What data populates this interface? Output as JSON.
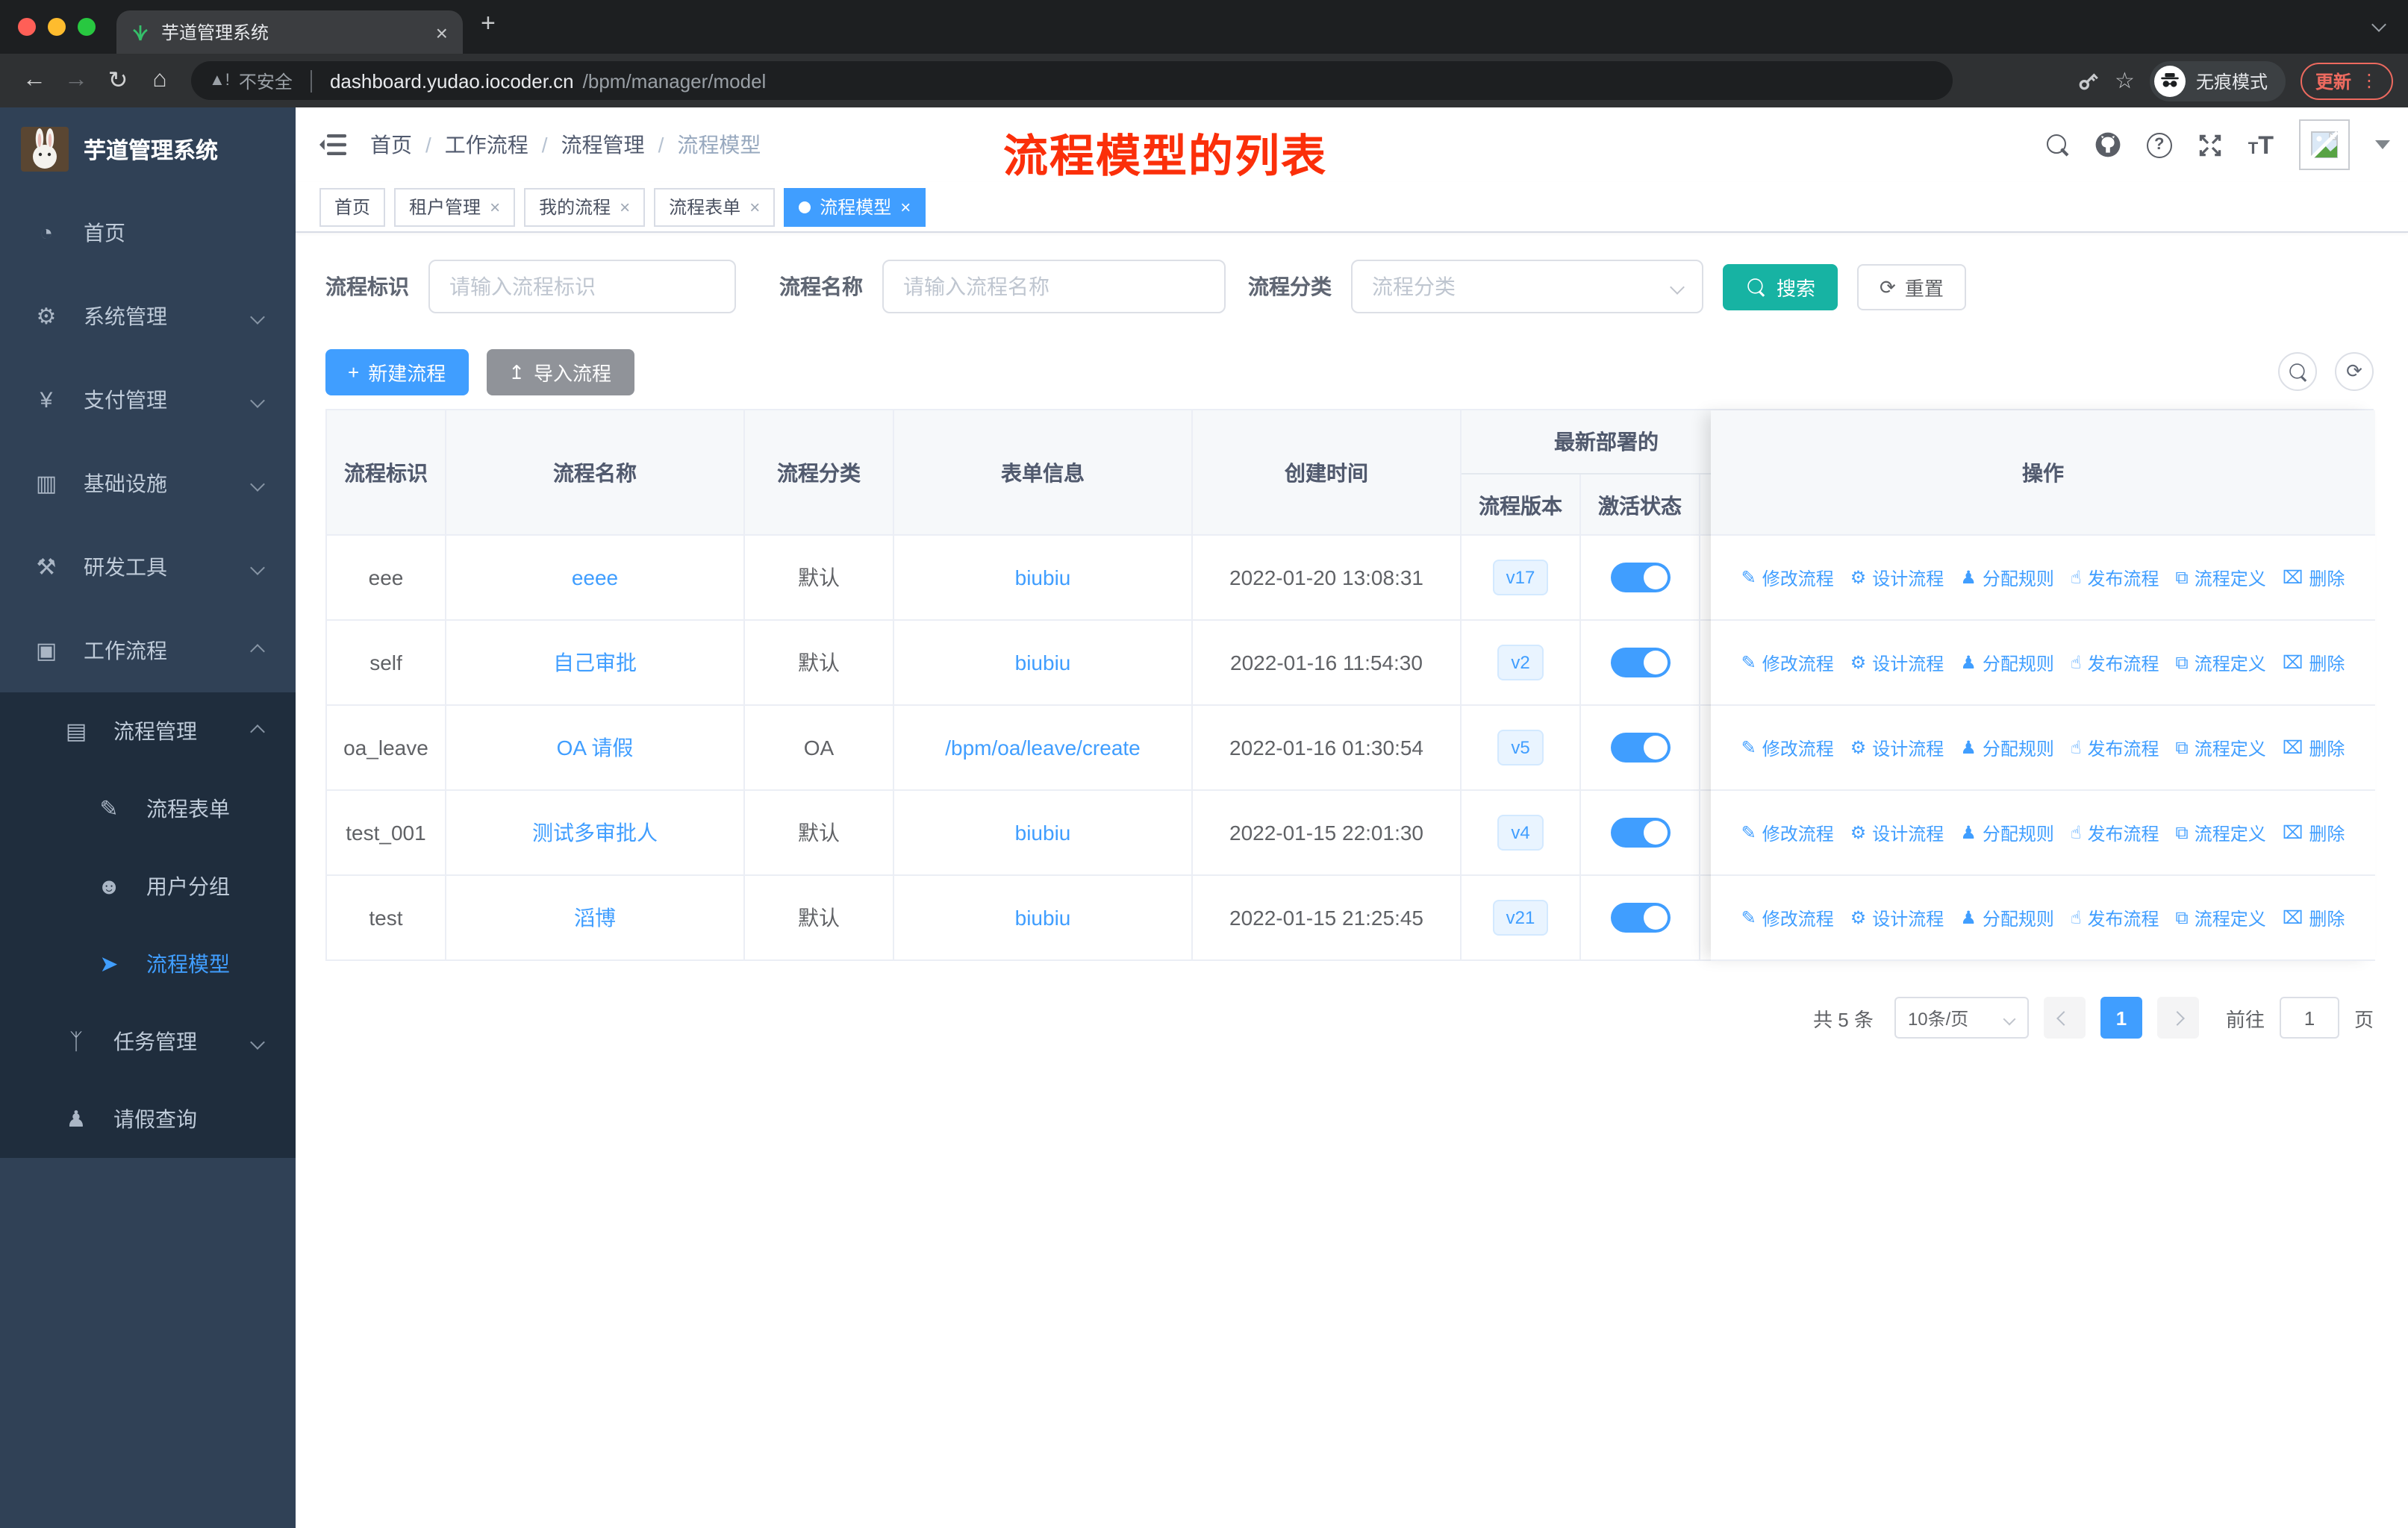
{
  "colors": {
    "primary": "#409eff",
    "search_button": "#17b3a3",
    "annotation_red": "#fb2f0a",
    "sidebar_bg": "#304156",
    "submenu_bg": "#1f2d3d"
  },
  "browser": {
    "tab_title": "芋道管理系统",
    "security_label": "不安全",
    "url_domain": "dashboard.yudao.iocoder.cn",
    "url_path": "/bpm/manager/model",
    "incognito_label": "无痕模式",
    "update_label": "更新"
  },
  "sidebar": {
    "app_title": "芋道管理系统",
    "menu": [
      {
        "key": "home",
        "label": "首页",
        "icon": "dashboard"
      },
      {
        "key": "system-management",
        "label": "系统管理",
        "icon": "gear",
        "chevron": "down"
      },
      {
        "key": "payment-management",
        "label": "支付管理",
        "icon": "yen",
        "chevron": "down"
      },
      {
        "key": "infrastructure",
        "label": "基础设施",
        "icon": "monitor",
        "chevron": "down"
      },
      {
        "key": "dev-tools",
        "label": "研发工具",
        "icon": "toolbox",
        "chevron": "down"
      },
      {
        "key": "workflow",
        "label": "工作流程",
        "icon": "briefcase",
        "chevron": "up"
      }
    ],
    "submenu": [
      {
        "key": "process-management",
        "label": "流程管理",
        "icon": "list",
        "chevron": "up",
        "level": 2
      },
      {
        "key": "process-form",
        "label": "流程表单",
        "icon": "form",
        "level": 3
      },
      {
        "key": "user-group",
        "label": "用户分组",
        "icon": "robot",
        "level": 3
      },
      {
        "key": "process-model",
        "label": "流程模型",
        "icon": "plane",
        "level": 3,
        "active": true
      },
      {
        "key": "task-management",
        "label": "任务管理",
        "icon": "tasks",
        "chevron": "down",
        "level": 2
      },
      {
        "key": "leave-query",
        "label": "请假查询",
        "icon": "user",
        "level": 2
      }
    ]
  },
  "header": {
    "breadcrumbs": [
      "首页",
      "工作流程",
      "流程管理",
      "流程模型"
    ],
    "annotation": "流程模型的列表"
  },
  "tags": [
    {
      "key": "home",
      "label": "首页",
      "closable": false,
      "active": false
    },
    {
      "key": "tenant-management",
      "label": "租户管理",
      "closable": true,
      "active": false
    },
    {
      "key": "my-process",
      "label": "我的流程",
      "closable": true,
      "active": false
    },
    {
      "key": "process-form",
      "label": "流程表单",
      "closable": true,
      "active": false
    },
    {
      "key": "process-model",
      "label": "流程模型",
      "closable": true,
      "active": true
    }
  ],
  "filters": {
    "id_label": "流程标识",
    "id_placeholder": "请输入流程标识",
    "name_label": "流程名称",
    "name_placeholder": "请输入流程名称",
    "category_label": "流程分类",
    "category_placeholder": "流程分类",
    "search_label": "搜索",
    "reset_label": "重置"
  },
  "toolbar": {
    "create_label": "新建流程",
    "import_label": "导入流程"
  },
  "table": {
    "columns": [
      "流程标识",
      "流程名称",
      "流程分类",
      "表单信息",
      "创建时间",
      "流程版本",
      "激活状态",
      "操作"
    ],
    "group_header": "最新部署的",
    "rows": [
      {
        "id": "eee",
        "name": "eeee",
        "category": "默认",
        "form": "biubiu",
        "created": "2022-01-20 13:08:31",
        "version": "v17",
        "active": true
      },
      {
        "id": "self",
        "name": "自己审批",
        "category": "默认",
        "form": "biubiu",
        "created": "2022-01-16 11:54:30",
        "version": "v2",
        "active": true
      },
      {
        "id": "oa_leave",
        "name": "OA 请假",
        "category": "OA",
        "form": "/bpm/oa/leave/create",
        "created": "2022-01-16 01:30:54",
        "version": "v5",
        "active": true
      },
      {
        "id": "test_001",
        "name": "测试多审批人",
        "category": "默认",
        "form": "biubiu",
        "created": "2022-01-15 22:01:30",
        "version": "v4",
        "active": true
      },
      {
        "id": "test",
        "name": "滔博",
        "category": "默认",
        "form": "biubiu",
        "created": "2022-01-15 21:25:45",
        "version": "v21",
        "active": true
      }
    ],
    "actions": [
      {
        "key": "modify",
        "label": "修改流程",
        "icon": "edit"
      },
      {
        "key": "design",
        "label": "设计流程",
        "icon": "design"
      },
      {
        "key": "assign-rule",
        "label": "分配规则",
        "icon": "assign-user"
      },
      {
        "key": "publish",
        "label": "发布流程",
        "icon": "publish"
      },
      {
        "key": "definition",
        "label": "流程定义",
        "icon": "definition"
      },
      {
        "key": "delete",
        "label": "删除",
        "icon": "delete"
      }
    ]
  },
  "pagination": {
    "total": "共 5 条",
    "page_size": "10条/页",
    "current_page": "1",
    "goto_label": "前往",
    "goto_value": "1",
    "page_unit": "页"
  }
}
